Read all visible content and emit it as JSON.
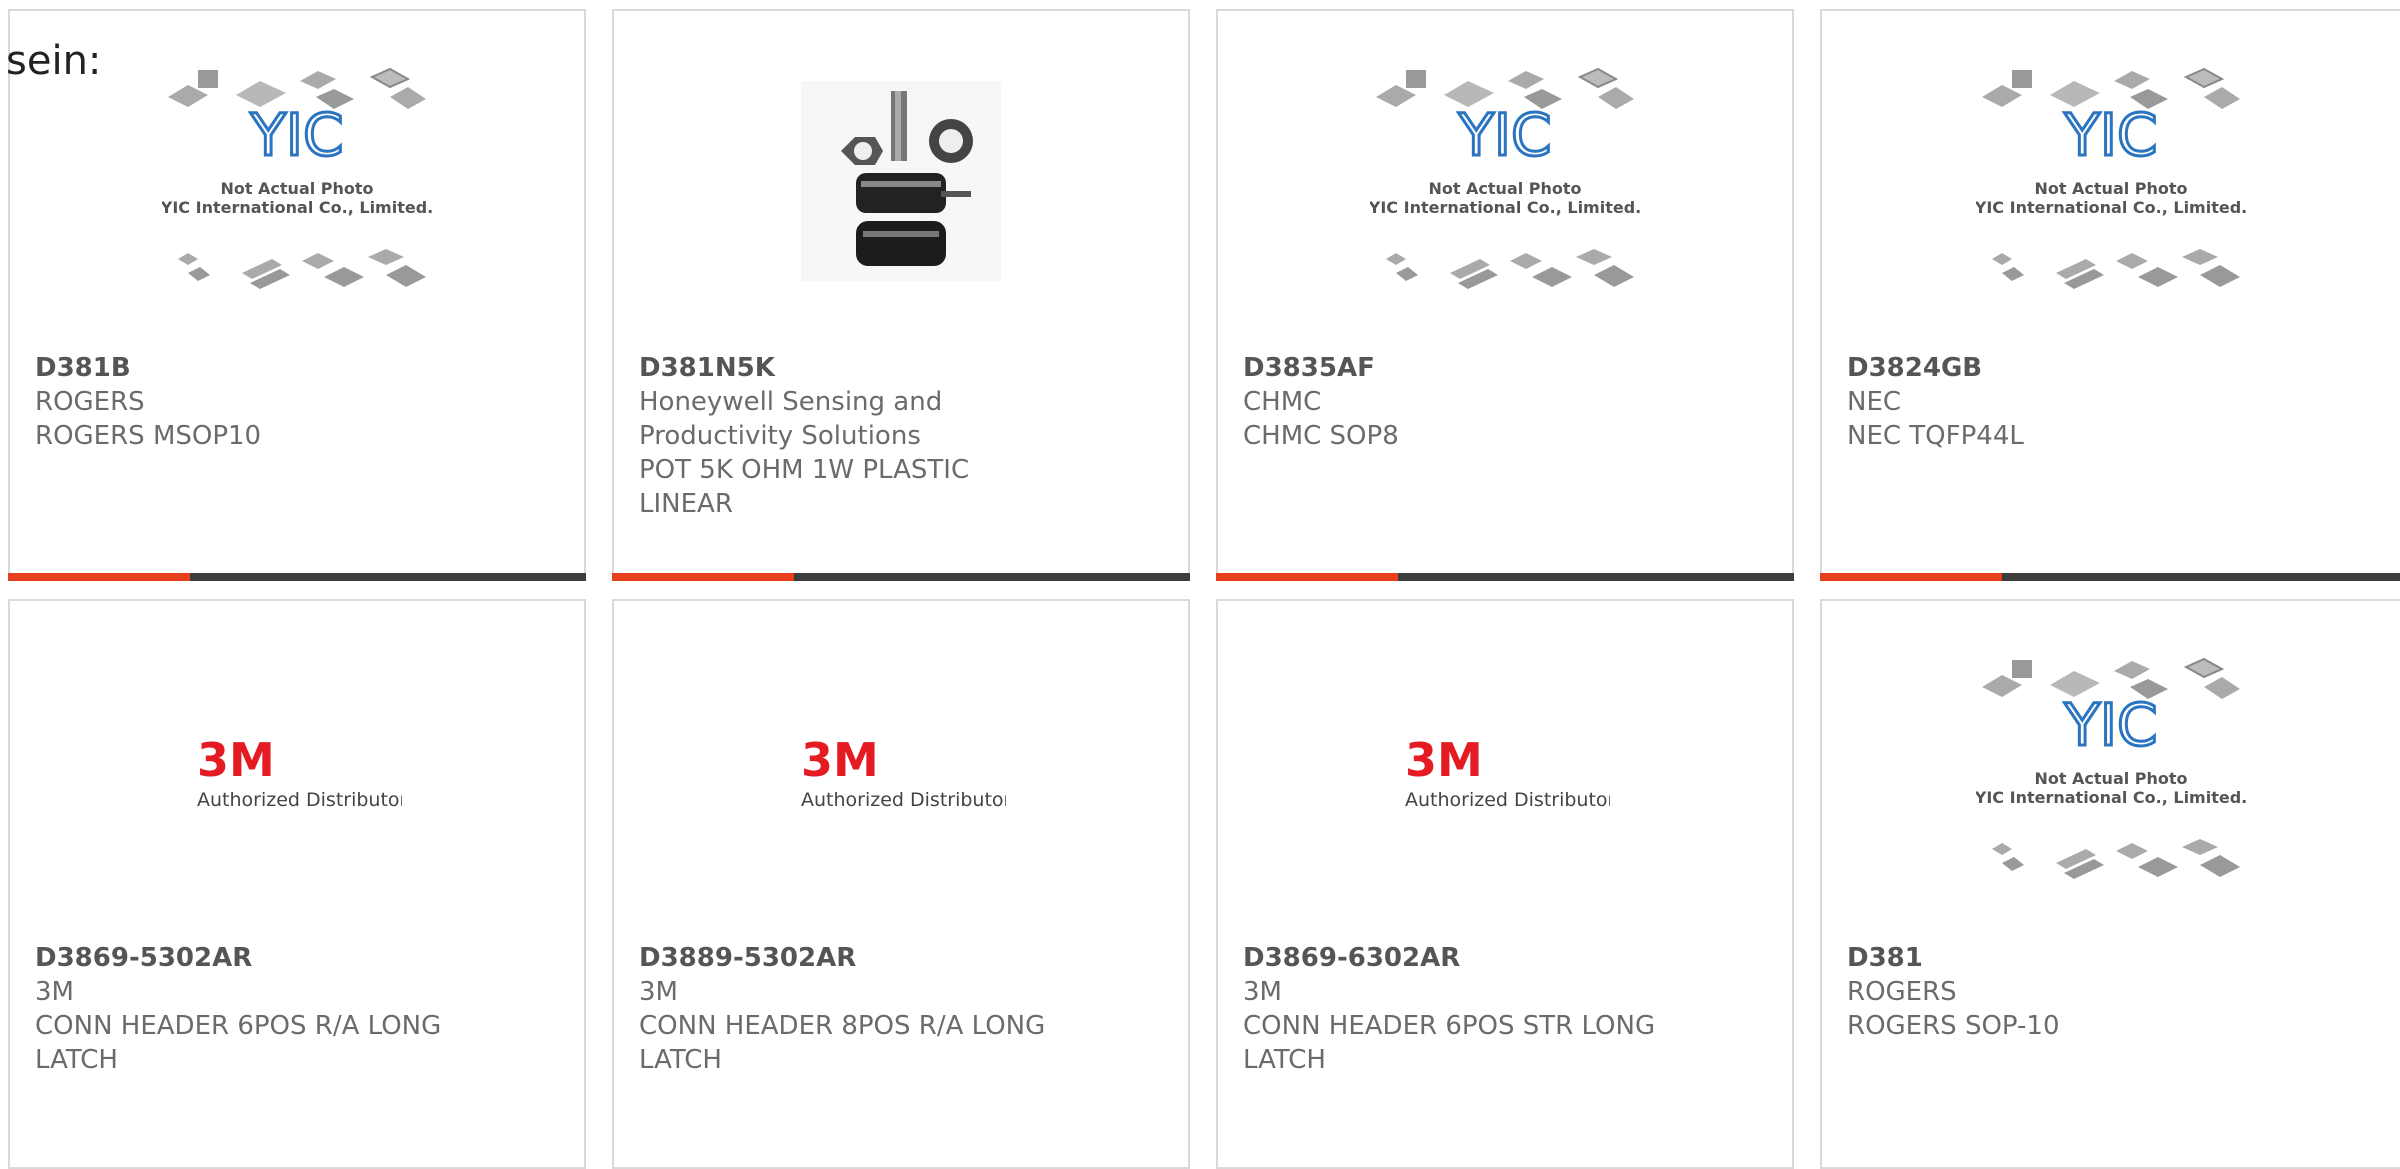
{
  "lead_text": "sein:",
  "placeholder": {
    "line1": "Not Actual Photo",
    "line2": "YIC International Co., Limited.",
    "logo": "YIC"
  },
  "distributor_logo": {
    "brand": "3M",
    "caption": "Authorized Distributor"
  },
  "accent_colors": {
    "bar_highlight": "#e8401c",
    "bar_base": "#3d3d3d",
    "brand_3m": "#e51b24",
    "yic_blue": "#1f6fb8"
  },
  "products": [
    {
      "part": "D381B",
      "maker": "ROGERS",
      "desc": "ROGERS MSOP10",
      "image": "yic-placeholder"
    },
    {
      "part": "D381N5K",
      "maker": "Honeywell Sensing and Productivity Solutions",
      "desc": "POT 5K OHM 1W PLASTIC LINEAR",
      "image": "potentiometer-photo"
    },
    {
      "part": "D3835AF",
      "maker": "CHMC",
      "desc": "CHMC SOP8",
      "image": "yic-placeholder"
    },
    {
      "part": "D3824GB",
      "maker": "NEC",
      "desc": "NEC TQFP44L",
      "image": "yic-placeholder"
    },
    {
      "part": "D3869-5302AR",
      "maker": "3M",
      "desc": "CONN HEADER 6POS R/A LONG LATCH",
      "image": "3m-logo"
    },
    {
      "part": "D3889-5302AR",
      "maker": "3M",
      "desc": "CONN HEADER 8POS R/A LONG LATCH",
      "image": "3m-logo"
    },
    {
      "part": "D3869-6302AR",
      "maker": "3M",
      "desc": "CONN HEADER 6POS STR LONG LATCH",
      "image": "3m-logo"
    },
    {
      "part": "D381",
      "maker": "ROGERS",
      "desc": "ROGERS SOP-10",
      "image": "yic-placeholder"
    }
  ]
}
